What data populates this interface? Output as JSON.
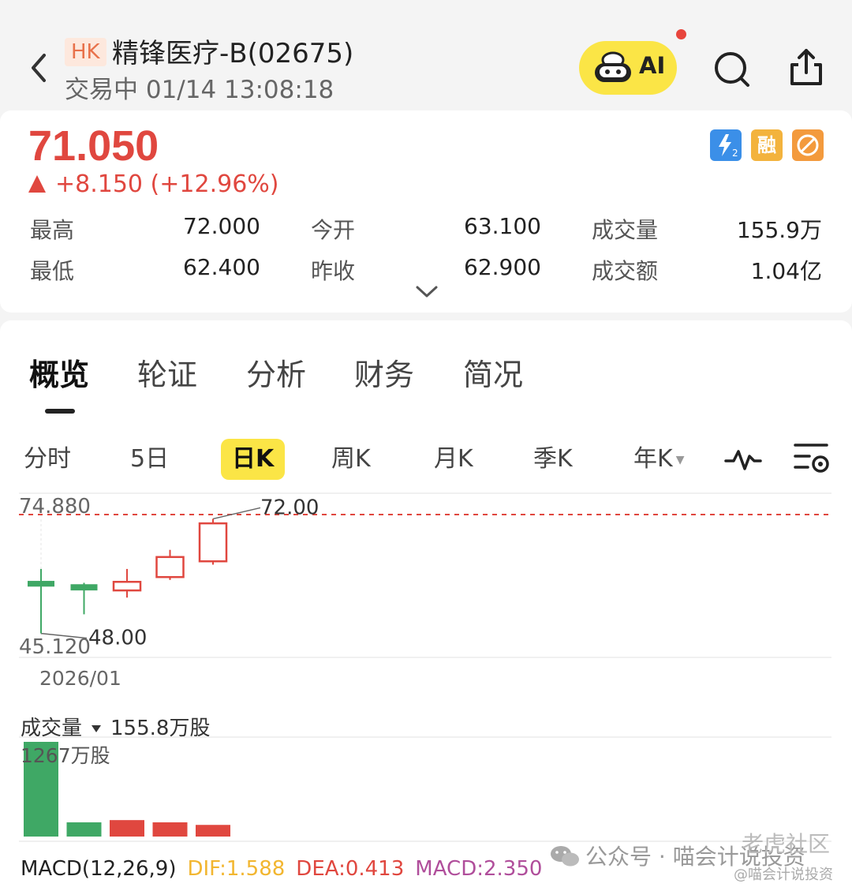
{
  "header": {
    "market_badge": "HK",
    "stock_name": "精锋医疗-B(02675)",
    "trade_status": "交易中 01/14 13:08:18",
    "ai_label": "AI"
  },
  "quote": {
    "price": "71.050",
    "change": "+8.150 (+12.96%)",
    "badge_margin": "融",
    "stats": [
      {
        "label": "最高",
        "value": "72.000"
      },
      {
        "label": "今开",
        "value": "63.100"
      },
      {
        "label": "成交量",
        "value": "155.9万"
      },
      {
        "label": "最低",
        "value": "62.400"
      },
      {
        "label": "昨收",
        "value": "62.900"
      },
      {
        "label": "成交额",
        "value": "1.04亿"
      }
    ]
  },
  "tabs": [
    "概览",
    "轮证",
    "分析",
    "财务",
    "简况"
  ],
  "periods": [
    "分时",
    "5日",
    "日K",
    "周K",
    "月K",
    "季K",
    "年K"
  ],
  "chart": {
    "y_top_label": "74.880",
    "y_bottom_label": "45.120",
    "high_marker": "72.00",
    "low_marker": "48.00",
    "date_label": "2026/01",
    "volume_label": "成交量",
    "volume_value": "155.8万股",
    "volume_max_label": "1267万股"
  },
  "macd": {
    "title": "MACD(12,26,9)",
    "dif": "DIF:1.588",
    "dea": "DEA:0.413",
    "macd": "MACD:2.350"
  },
  "watermark": {
    "text": "公众号 · 喵会计说投资",
    "brand": "老虎社区",
    "handle": "@喵会计说投资"
  },
  "colors": {
    "up": "#e0473f",
    "down": "#3fa865",
    "accent_yellow": "#fbe546",
    "dif": "#f2b630",
    "dea": "#e0473f",
    "macd": "#b04e9b"
  },
  "chart_data": {
    "type": "candlestick",
    "x_label": "2026/01",
    "ylim": [
      45.12,
      74.88
    ],
    "candles": [
      {
        "open": 59.0,
        "close": 57.8,
        "high": 61.5,
        "low": 48.0,
        "dir": "down"
      },
      {
        "open": 58.3,
        "close": 57.0,
        "high": 58.6,
        "low": 52.0,
        "dir": "down"
      },
      {
        "open": 57.0,
        "close": 58.8,
        "high": 61.5,
        "low": 55.5,
        "dir": "up"
      },
      {
        "open": 59.8,
        "close": 64.0,
        "high": 65.5,
        "low": 59.2,
        "dir": "up"
      },
      {
        "open": 63.1,
        "close": 71.05,
        "high": 72.0,
        "low": 62.4,
        "dir": "up"
      }
    ],
    "reference_line": 74.88,
    "volume": {
      "unit": "万股",
      "max": 1267,
      "values": [
        1267,
        190,
        220,
        190,
        155.8
      ],
      "dirs": [
        "down",
        "down",
        "up",
        "up",
        "up"
      ]
    }
  }
}
